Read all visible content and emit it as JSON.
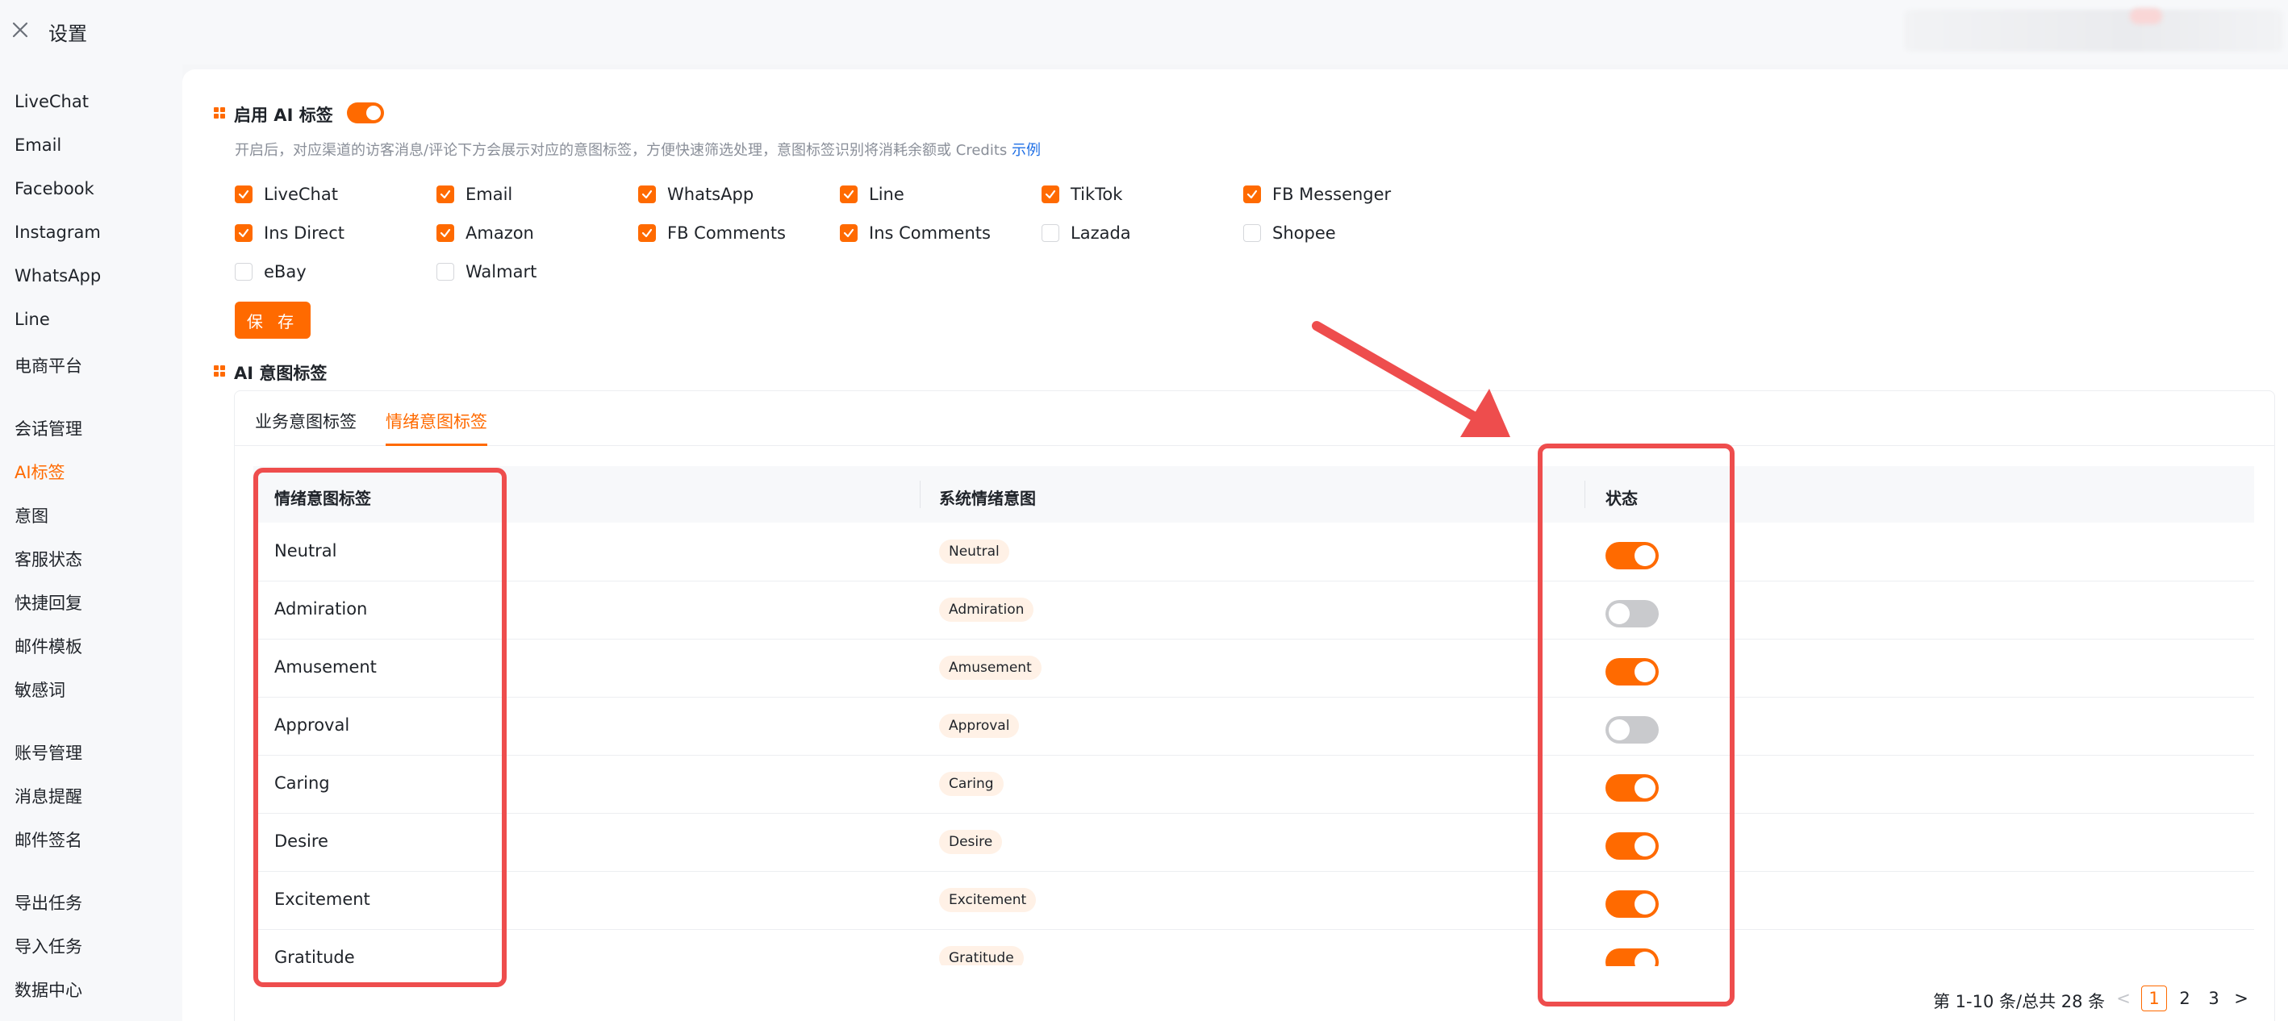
{
  "header": {
    "title": "设置"
  },
  "sidebar": {
    "items": [
      {
        "label": "LiveChat"
      },
      {
        "label": "Email"
      },
      {
        "label": "Facebook"
      },
      {
        "label": "Instagram"
      },
      {
        "label": "WhatsApp"
      },
      {
        "label": "Line"
      },
      {
        "label": "电商平台"
      },
      {
        "label": "会话管理"
      },
      {
        "label": "AI标签"
      },
      {
        "label": "意图"
      },
      {
        "label": "客服状态"
      },
      {
        "label": "快捷回复"
      },
      {
        "label": "邮件模板"
      },
      {
        "label": "敏感词"
      },
      {
        "label": "账号管理"
      },
      {
        "label": "消息提醒"
      },
      {
        "label": "邮件签名"
      },
      {
        "label": "导出任务"
      },
      {
        "label": "导入任务"
      },
      {
        "label": "数据中心"
      }
    ],
    "active": "AI标签"
  },
  "enable_section": {
    "title": "启用 AI 标签",
    "enabled": true,
    "description": "开启后，对应渠道的访客消息/评论下方会展示对应的意图标签，方便快速筛选处理，意图标签识别将消耗余额或 Credits",
    "example_link": "示例",
    "channels": [
      {
        "label": "LiveChat",
        "checked": true
      },
      {
        "label": "Email",
        "checked": true
      },
      {
        "label": "WhatsApp",
        "checked": true
      },
      {
        "label": "Line",
        "checked": true
      },
      {
        "label": "TikTok",
        "checked": true
      },
      {
        "label": "FB Messenger",
        "checked": true
      },
      {
        "label": "Ins Direct",
        "checked": true
      },
      {
        "label": "Amazon",
        "checked": true
      },
      {
        "label": "FB Comments",
        "checked": true
      },
      {
        "label": "Ins Comments",
        "checked": true
      },
      {
        "label": "Lazada",
        "checked": false
      },
      {
        "label": "Shopee",
        "checked": false
      },
      {
        "label": "eBay",
        "checked": false
      },
      {
        "label": "Walmart",
        "checked": false
      }
    ],
    "save_label": "保 存"
  },
  "intent_section": {
    "title": "AI 意图标签",
    "tabs": [
      {
        "label": "业务意图标签",
        "active": false
      },
      {
        "label": "情绪意图标签",
        "active": true
      }
    ],
    "columns": {
      "name": "情绪意图标签",
      "system": "系统情绪意图",
      "status": "状态"
    },
    "rows": [
      {
        "name": "Neutral",
        "system": "Neutral",
        "enabled": true
      },
      {
        "name": "Admiration",
        "system": "Admiration",
        "enabled": false
      },
      {
        "name": "Amusement",
        "system": "Amusement",
        "enabled": true
      },
      {
        "name": "Approval",
        "system": "Approval",
        "enabled": false
      },
      {
        "name": "Caring",
        "system": "Caring",
        "enabled": true
      },
      {
        "name": "Desire",
        "system": "Desire",
        "enabled": true
      },
      {
        "name": "Excitement",
        "system": "Excitement",
        "enabled": true
      },
      {
        "name": "Gratitude",
        "system": "Gratitude",
        "enabled": true
      }
    ]
  },
  "pagination": {
    "summary": "第 1-10 条/总共 28 条",
    "pages": [
      "1",
      "2",
      "3"
    ],
    "current": "1",
    "prev": "<",
    "next": ">"
  },
  "colors": {
    "accent": "#ff6a00",
    "annotation_red": "#ee4d4d",
    "link": "#1f6fe5"
  }
}
